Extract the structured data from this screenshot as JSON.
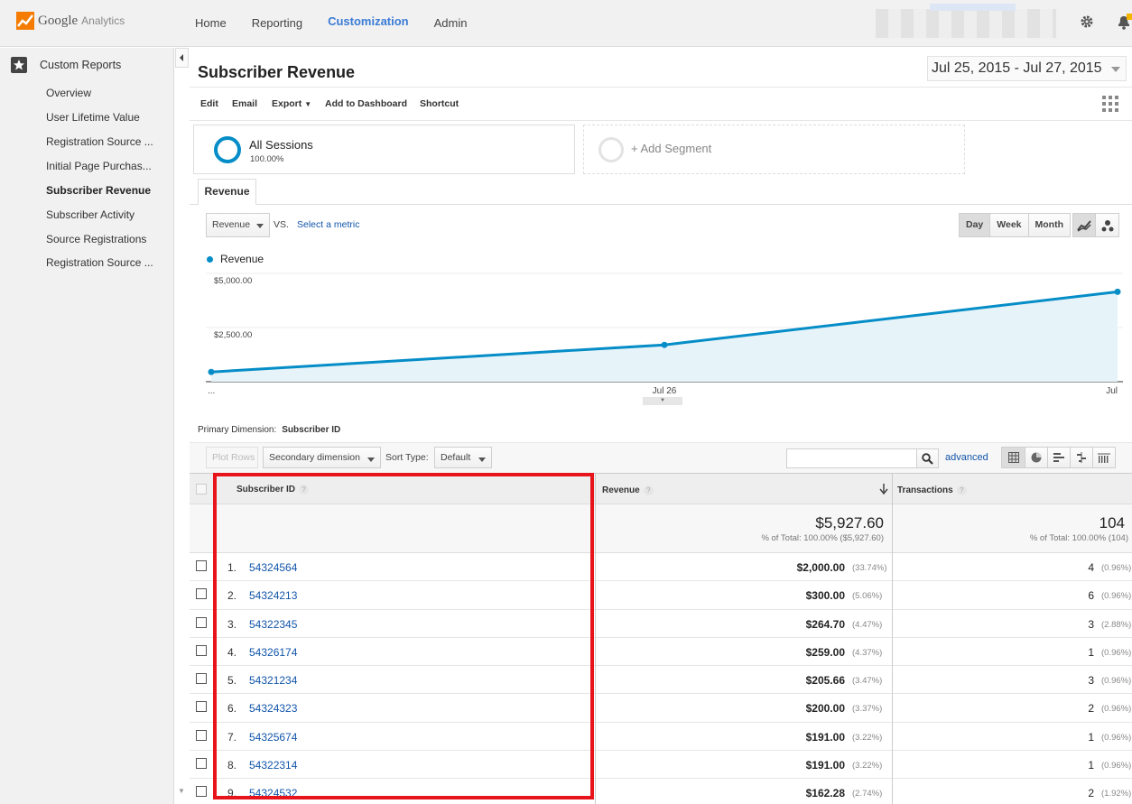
{
  "header": {
    "brand": "Google",
    "product": "Analytics",
    "nav": [
      "Home",
      "Reporting",
      "Customization",
      "Admin"
    ],
    "active_nav": "Customization"
  },
  "sidebar": {
    "section_title": "Custom Reports",
    "items": [
      {
        "label": "Overview"
      },
      {
        "label": "User Lifetime Value"
      },
      {
        "label": "Registration Source ..."
      },
      {
        "label": "Initial Page Purchas..."
      },
      {
        "label": "Subscriber Revenue",
        "selected": true
      },
      {
        "label": "Subscriber Activity"
      },
      {
        "label": "Source Registrations"
      },
      {
        "label": "Registration Source ..."
      }
    ]
  },
  "report": {
    "title": "Subscriber Revenue",
    "date_range": "Jul 25, 2015 - Jul 27, 2015",
    "toolbar": {
      "edit": "Edit",
      "email": "Email",
      "export": "Export",
      "add_dashboard": "Add to Dashboard",
      "shortcut": "Shortcut"
    },
    "segments": {
      "all_sessions": "All Sessions",
      "all_sessions_pct": "100.00%",
      "add_segment": "+ Add Segment"
    },
    "tab": "Revenue",
    "metric_select": "Revenue",
    "vs": "VS.",
    "select_metric": "Select a metric",
    "granularity": [
      "Day",
      "Week",
      "Month"
    ],
    "active_granularity": "Day",
    "primary_dimension_label": "Primary Dimension:",
    "primary_dimension": "Subscriber ID"
  },
  "chart_data": {
    "type": "area",
    "x": [
      "...",
      "Jul 26",
      "Jul"
    ],
    "series": [
      {
        "name": "Revenue",
        "values": [
          450,
          1700,
          4150
        ]
      }
    ],
    "y_tick_labels": [
      "$5,000.00",
      "$2,500.00"
    ],
    "ylim": [
      0,
      5000
    ],
    "color": "#058dc7"
  },
  "table_controls": {
    "plot_rows": "Plot Rows",
    "secondary_dimension": "Secondary dimension",
    "sort_type_label": "Sort Type:",
    "sort_type": "Default",
    "advanced": "advanced",
    "search_value": ""
  },
  "table": {
    "columns": {
      "subscriber_id": "Subscriber ID",
      "revenue": "Revenue",
      "transactions": "Transactions"
    },
    "totals": {
      "revenue": "$5,927.60",
      "revenue_sub": "% of Total: 100.00% ($5,927.60)",
      "transactions": "104",
      "transactions_sub": "% of Total: 100.00% (104)"
    },
    "rows": [
      {
        "n": "1.",
        "id": "54324564",
        "revenue": "$2,000.00",
        "revenue_pct": "(33.74%)",
        "transactions": "4",
        "transactions_pct": "(0.96%)"
      },
      {
        "n": "2.",
        "id": "54324213",
        "revenue": "$300.00",
        "revenue_pct": "(5.06%)",
        "transactions": "6",
        "transactions_pct": "(0.96%)"
      },
      {
        "n": "3.",
        "id": "54322345",
        "revenue": "$264.70",
        "revenue_pct": "(4.47%)",
        "transactions": "3",
        "transactions_pct": "(2.88%)"
      },
      {
        "n": "4.",
        "id": "54326174",
        "revenue": "$259.00",
        "revenue_pct": "(4.37%)",
        "transactions": "1",
        "transactions_pct": "(0.96%)"
      },
      {
        "n": "5.",
        "id": "54321234",
        "revenue": "$205.66",
        "revenue_pct": "(3.47%)",
        "transactions": "3",
        "transactions_pct": "(0.96%)"
      },
      {
        "n": "6.",
        "id": "54324323",
        "revenue": "$200.00",
        "revenue_pct": "(3.37%)",
        "transactions": "2",
        "transactions_pct": "(0.96%)"
      },
      {
        "n": "7.",
        "id": "54325674",
        "revenue": "$191.00",
        "revenue_pct": "(3.22%)",
        "transactions": "1",
        "transactions_pct": "(0.96%)"
      },
      {
        "n": "8.",
        "id": "54322314",
        "revenue": "$191.00",
        "revenue_pct": "(3.22%)",
        "transactions": "1",
        "transactions_pct": "(0.96%)"
      },
      {
        "n": "9.",
        "id": "54324532",
        "revenue": "$162.28",
        "revenue_pct": "(2.74%)",
        "transactions": "2",
        "transactions_pct": "(1.92%)"
      }
    ]
  },
  "colors": {
    "accent": "#058dc7",
    "nav_active": "#3a7bd5",
    "link": "#1155aa",
    "highlight_box": "#e8141b"
  }
}
